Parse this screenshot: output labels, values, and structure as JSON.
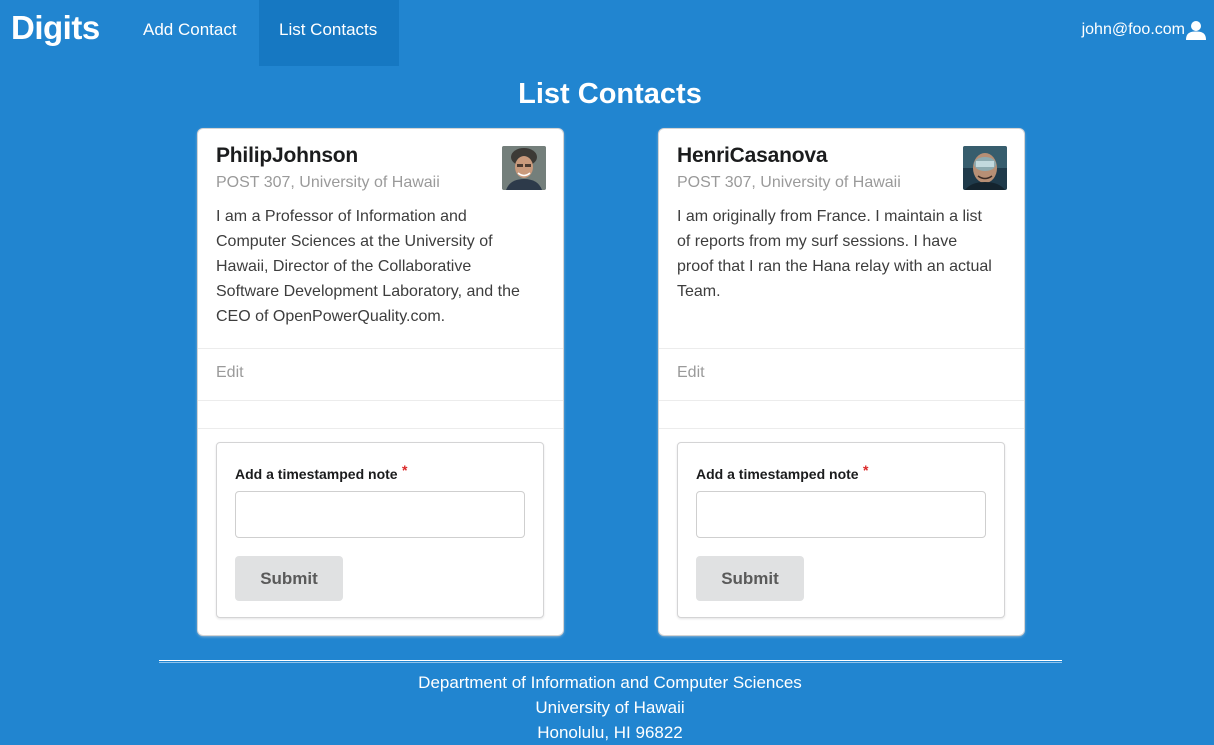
{
  "app": {
    "brand": "Digits"
  },
  "nav": {
    "add_contact": "Add Contact",
    "list_contacts": "List Contacts",
    "active": "List Contacts"
  },
  "user": {
    "email": "john@foo.com",
    "icon": "user-icon"
  },
  "page": {
    "title": "List Contacts"
  },
  "contacts": [
    {
      "name": "PhilipJohnson",
      "address": "POST 307, University of Hawaii",
      "description": "I am a Professor of Information and Computer Sciences at the University of Hawaii, Director of the Collaborative Software Development Laboratory, and the CEO of OpenPowerQuality.com.",
      "edit_label": "Edit",
      "note_label": "Add a timestamped note",
      "note_required_mark": "*",
      "note_value": "",
      "submit_label": "Submit"
    },
    {
      "name": "HenriCasanova",
      "address": "POST 307, University of Hawaii",
      "description": "I am originally from France. I maintain a list of reports from my surf sessions. I have proof that I ran the Hana relay with an actual Team.",
      "edit_label": "Edit",
      "note_label": "Add a timestamped note",
      "note_required_mark": "*",
      "note_value": "",
      "submit_label": "Submit"
    }
  ],
  "footer": {
    "line1": "Department of Information and Computer Sciences",
    "line2": "University of Hawaii",
    "line3": "Honolulu, HI 96822"
  },
  "colors": {
    "background": "#2185d0",
    "active_nav": "#1678c2",
    "required": "#db2828",
    "button": "#e0e1e2"
  }
}
